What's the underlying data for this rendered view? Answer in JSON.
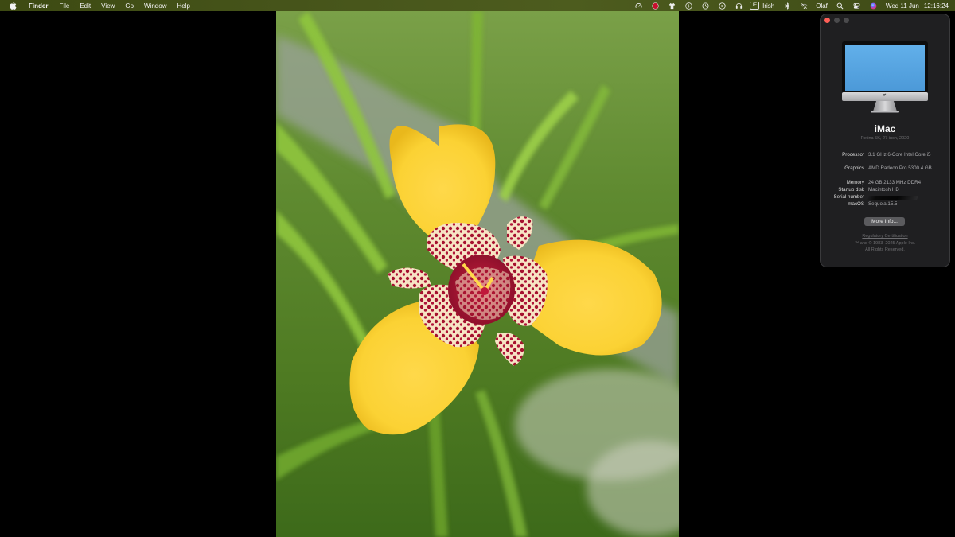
{
  "menubar": {
    "app_name": "Finder",
    "menus": [
      "File",
      "Edit",
      "View",
      "Go",
      "Window",
      "Help"
    ],
    "status_icons": [
      "speedometer-icon",
      "red-record-icon",
      "shirt-icon",
      "bolt-icon",
      "clock-restore-icon",
      "play-circle-icon",
      "headphones-icon"
    ],
    "input_source_badge": "IE",
    "input_source_label": "Irish",
    "user_name": "Olaf",
    "date": "Wed 11 Jun",
    "time": "12:16:24"
  },
  "about_window": {
    "model": "iMac",
    "model_subtitle": "Retina 5K, 27-inch, 2020",
    "specs": [
      {
        "label": "Processor",
        "value": "3.1 GHz 6-Core Intel Core i5"
      },
      {
        "label": "Graphics",
        "value": "AMD Radeon Pro 5300 4 GB"
      },
      {
        "label": "Memory",
        "value": "24 GB 2133 MHz DDR4"
      },
      {
        "label": "Startup disk",
        "value": "Macintosh HD"
      },
      {
        "label": "Serial number",
        "value": ""
      },
      {
        "label": "macOS",
        "value": "Sequoia 15.5"
      }
    ],
    "more_info_button": "More Info...",
    "regulatory_link": "Regulatory Certification",
    "copyright_line1": "™ and © 1983–2025 Apple Inc.",
    "copyright_line2": "All Rights Reserved.",
    "colors": {
      "close": "#ff5f57",
      "window_bg": "#1f1f21",
      "screen_blue": "#5aa9e6"
    }
  }
}
